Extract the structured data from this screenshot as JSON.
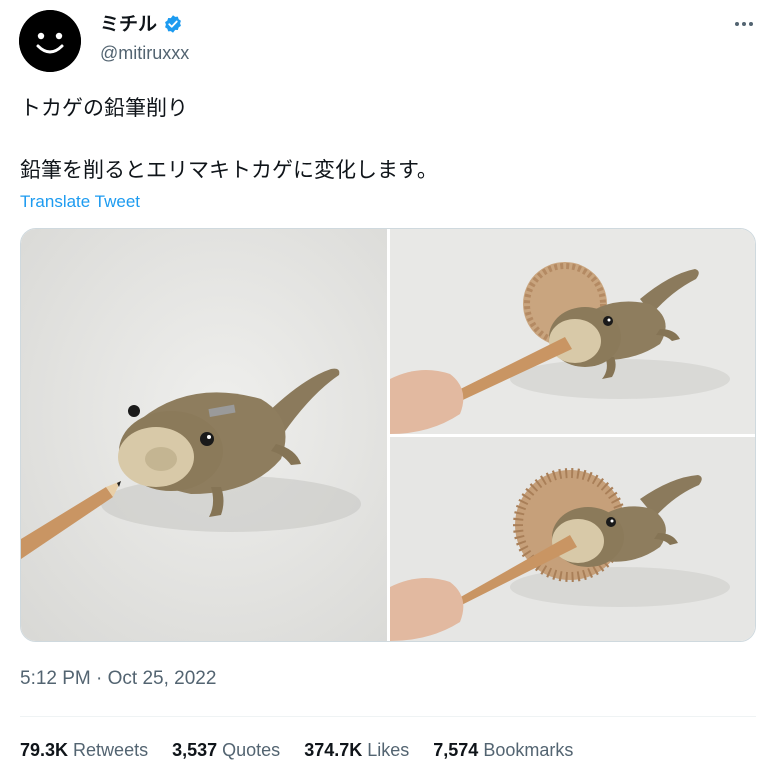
{
  "author": {
    "display_name": "ミチル",
    "handle": "@mitiruxxx",
    "verified": true,
    "avatar_icon": "smiley-face-icon"
  },
  "menu": {
    "icon": "more-icon"
  },
  "tweet": {
    "line1": "トカゲの鉛筆削り",
    "line2": "鉛筆を削るとエリマキトカゲに変化します。",
    "translate_label": "Translate Tweet"
  },
  "media": {
    "photos": [
      {
        "subject": "lizard-sharpener-with-pencil"
      },
      {
        "subject": "lizard-sharpener-with-frill-shavings"
      },
      {
        "subject": "lizard-sharpener-full-frill"
      }
    ]
  },
  "timestamp": "5:12 PM · Oct 25, 2022",
  "stats": [
    {
      "value": "79.3K",
      "label": "Retweets"
    },
    {
      "value": "3,537",
      "label": "Quotes"
    },
    {
      "value": "374.7K",
      "label": "Likes"
    },
    {
      "value": "7,574",
      "label": "Bookmarks"
    }
  ],
  "colors": {
    "link": "#1d9bf0",
    "secondary_text": "#536471",
    "primary_text": "#0f1419",
    "verified_badge": "#1d9bf0"
  }
}
